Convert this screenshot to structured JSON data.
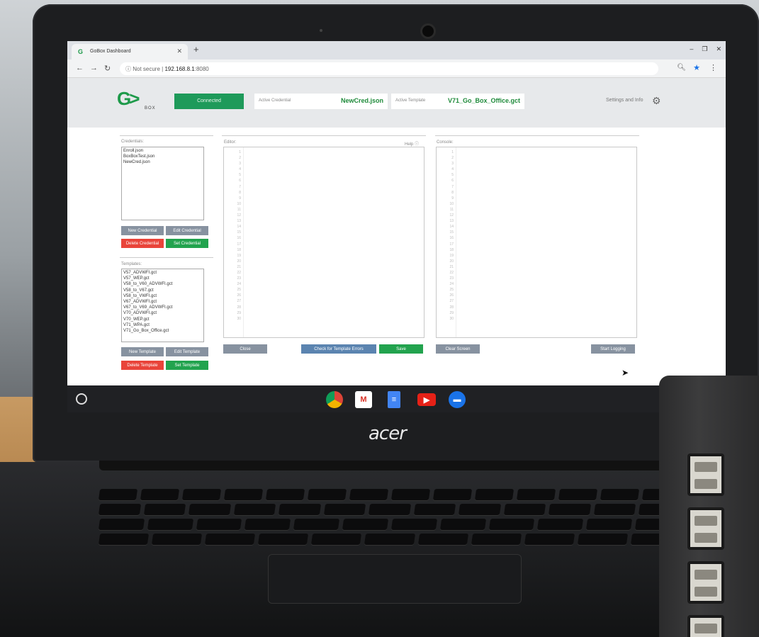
{
  "browser": {
    "tab_title": "GoBox Dashboard",
    "new_tab": "+",
    "address_security": "Not secure",
    "address_host": "192.168.8.1",
    "address_port": ":8080"
  },
  "header": {
    "logo_text": "G>",
    "logo_sub": "BOX",
    "status": "Connected",
    "credential_label": "Active Credential",
    "credential_value": "NewCred.json",
    "template_label": "Active Template",
    "template_value": "V71_Go_Box_Office.gct",
    "settings_label": "Settings and Info"
  },
  "credentials": {
    "label": "Credentials:",
    "items": [
      "Enroll.json",
      "BoxBoxTest.json",
      "NewCred.json"
    ],
    "buttons": {
      "new": "New Credential",
      "edit": "Edit Credential",
      "delete": "Delete Credential",
      "set": "Set Credential"
    }
  },
  "templates": {
    "label": "Templates:",
    "items": [
      "V57_ADVWFI.gct",
      "V57_WEP.gct",
      "V58_to_V60_ADVWFI.gct",
      "V58_to_V67.gct",
      "V58_to_VWFI.gct",
      "V67_ADVWFI.gct",
      "V67_to_V69_ADVWFI.gct",
      "V70_ADVWFI.gct",
      "V70_WEP.gct",
      "V71_WPA.gct",
      "V71_Go_Box_Office.gct"
    ],
    "buttons": {
      "new": "New Template",
      "edit": "Edit Template",
      "delete": "Delete Template",
      "set": "Set Template"
    }
  },
  "editor": {
    "label": "Editor:",
    "help": "Help ⓘ",
    "line_count": 30,
    "buttons": {
      "close": "Close",
      "check": "Check for Template Errors",
      "save": "Save"
    }
  },
  "console": {
    "label": "Console:",
    "line_count": 30,
    "buttons": {
      "clear": "Clear Screen",
      "logging": "Start Logging"
    }
  },
  "laptop": {
    "brand": "acer"
  },
  "colors": {
    "accent_green": "#22a34e",
    "danger": "#e9443a",
    "neutral": "#8792a0",
    "info": "#5b84b0"
  }
}
